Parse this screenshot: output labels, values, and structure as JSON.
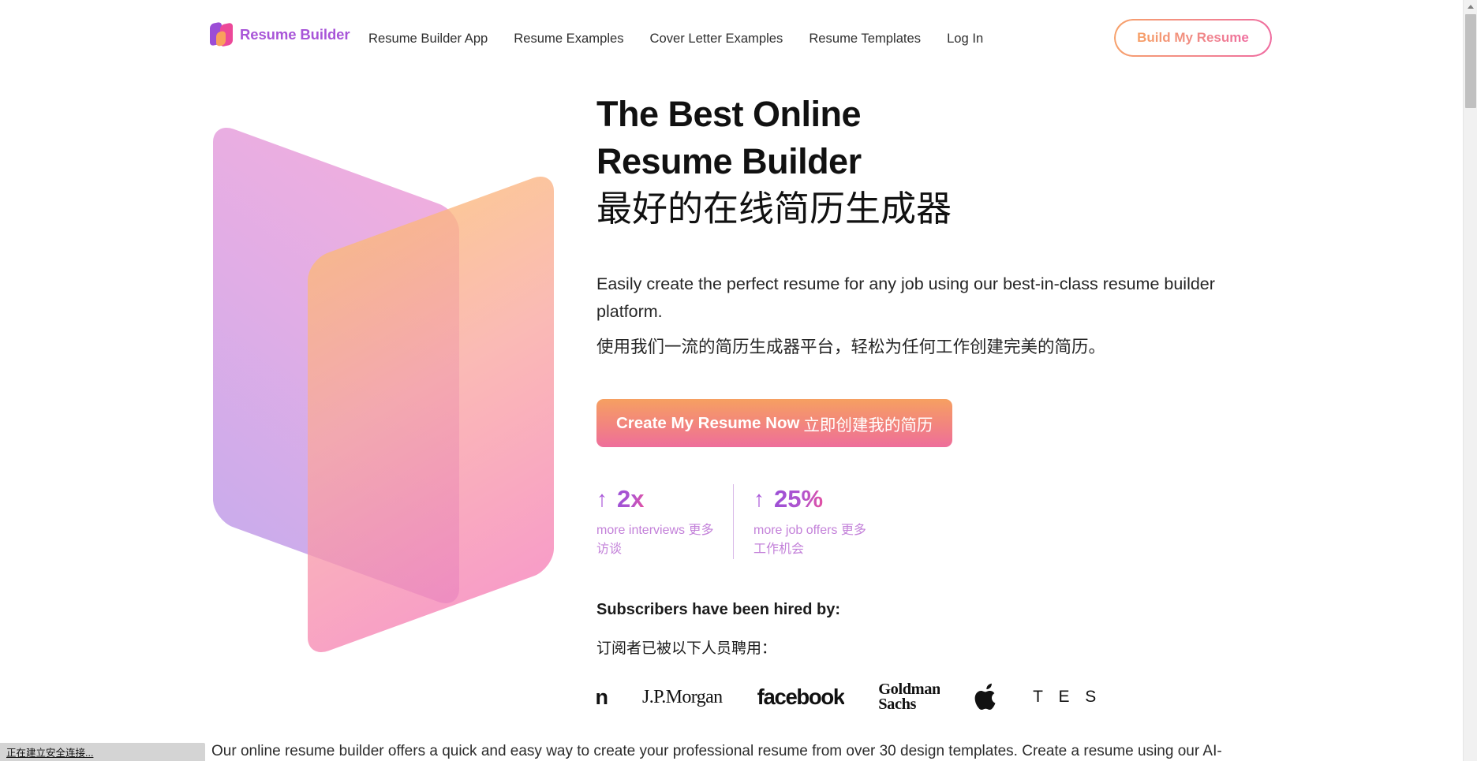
{
  "brand": {
    "name": "Resume Builder",
    "mark": "logo-mark-icon"
  },
  "nav": {
    "items": [
      {
        "label": "Resume Builder App"
      },
      {
        "label": "Resume Examples"
      },
      {
        "label": "Cover Letter Examples"
      },
      {
        "label": "Resume Templates"
      },
      {
        "label": "Log In"
      }
    ],
    "cta_label": "Build My Resume"
  },
  "hero": {
    "headline_en_line1": "The Best Online",
    "headline_en_line2": "Resume Builder",
    "headline_zh": "最好的在线简历生成器",
    "subhead_en": "Easily create the perfect resume for any job using our best-in-class resume builder platform.",
    "subhead_zh": "使用我们一流的简历生成器平台，轻松为任何工作创建完美的简历。",
    "cta_en": "Create My Resume Now",
    "cta_zh": "立即创建我的简历",
    "stats": [
      {
        "arrow": "↑",
        "value": "2x",
        "label": "more interviews 更多访谈"
      },
      {
        "arrow": "↑",
        "value": "25%",
        "label": "more job offers 更多工作机会"
      }
    ],
    "hired_title_en": "Subscribers have been hired by:",
    "hired_title_zh": "订阅者已被以下人员聘用：",
    "logos": [
      {
        "name": "amazon-logo",
        "text": "amazon"
      },
      {
        "name": "jpmorgan-logo",
        "text": "J.P.Morgan"
      },
      {
        "name": "facebook-logo",
        "text": "facebook"
      },
      {
        "name": "goldman-sachs-logo",
        "line1": "Goldman",
        "line2": "Sachs"
      },
      {
        "name": "apple-logo",
        "text": ""
      },
      {
        "name": "tesla-logo",
        "text": "T E S L A"
      }
    ]
  },
  "below_fold": {
    "paragraph": "Our online resume builder offers a quick and easy way to create your professional resume from over 30 design templates. Create a resume using our AI-"
  },
  "statusbar": {
    "text": "正在建立安全连接..."
  },
  "colors": {
    "brand_purple": "#a855d8",
    "accent_orange": "#f6a061",
    "accent_pink": "#ee6e9b",
    "stat_label": "#c381d9"
  }
}
